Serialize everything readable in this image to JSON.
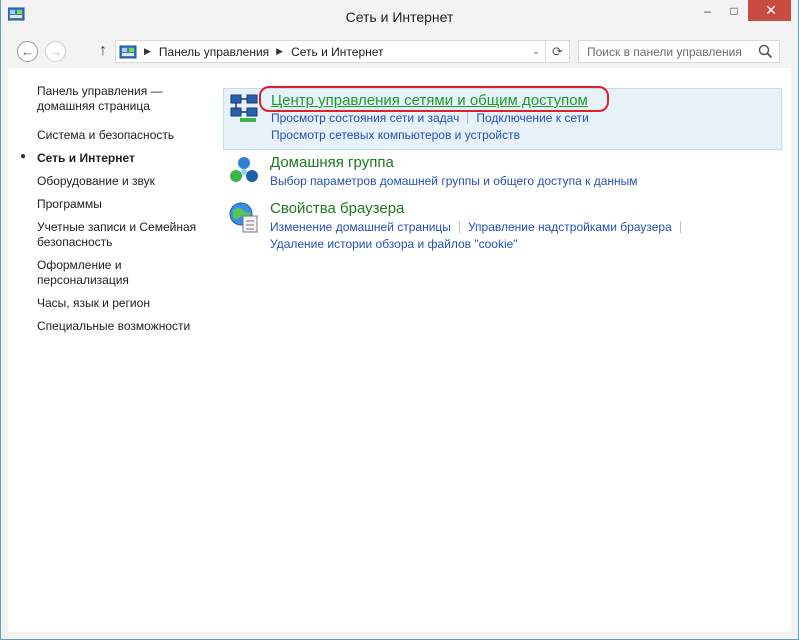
{
  "window": {
    "title": "Сеть и Интернет",
    "close_glyph": "✕",
    "minimize_glyph": "–",
    "maximize_glyph": "□"
  },
  "nav": {
    "back_glyph": "←",
    "forward_glyph": "→",
    "up_glyph": "↑",
    "breadcrumbs": [
      "Панель управления",
      "Сеть и Интернет"
    ],
    "breadcrumb_sep": "▶",
    "dropdown_glyph": "⌄",
    "refresh_glyph": "⟳",
    "search_placeholder": "Поиск в панели управления"
  },
  "sidebar": {
    "items": [
      {
        "label": "Панель управления — домашняя страница"
      },
      {
        "label": "Система и безопасность"
      },
      {
        "label": "Сеть и Интернет",
        "current": true
      },
      {
        "label": "Оборудование и звук"
      },
      {
        "label": "Программы"
      },
      {
        "label": "Учетные записи и Семейная безопасность"
      },
      {
        "label": "Оформление и персонализация"
      },
      {
        "label": "Часы, язык и регион"
      },
      {
        "label": "Специальные возможности"
      }
    ],
    "bullet": "●"
  },
  "categories": [
    {
      "title": "Центр управления сетями и общим доступом",
      "icon": "network-center-icon",
      "links": [
        "Просмотр состояния сети и задач",
        "Подключение к сети",
        "Просмотр сетевых компьютеров и устройств"
      ]
    },
    {
      "title": "Домашняя группа",
      "icon": "homegroup-icon",
      "links": [
        "Выбор параметров домашней группы и общего доступа к данным"
      ]
    },
    {
      "title": "Свойства браузера",
      "icon": "browser-options-icon",
      "links": [
        "Изменение домашней страницы",
        "Управление надстройками браузера",
        "Удаление истории обзора и файлов \"cookie\""
      ]
    }
  ],
  "colors": {
    "accent_title": "#1d9d2a",
    "link": "#2350b8",
    "highlight": "#e0202a",
    "close": "#c74b40"
  }
}
